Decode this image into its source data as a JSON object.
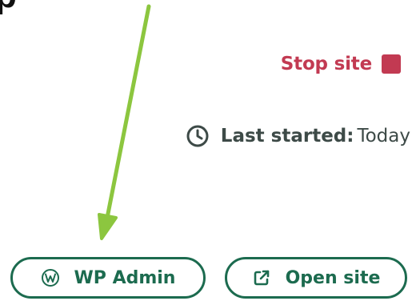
{
  "header": {
    "title_fragment": "p"
  },
  "controls": {
    "stop_site_label": "Stop site",
    "stop_color": "#c23a52",
    "last_started_key": "Last started:",
    "last_started_value": "Today"
  },
  "actions": {
    "wp_admin_label": "WP Admin",
    "open_site_label": "Open site",
    "accent_color": "#1c6b4f"
  },
  "annotation": {
    "arrow_color": "#8cc63f"
  },
  "icons": {
    "clock": "clock-icon",
    "wordpress": "wordpress-icon",
    "external_link": "external-link-icon",
    "stop": "stop-icon"
  }
}
